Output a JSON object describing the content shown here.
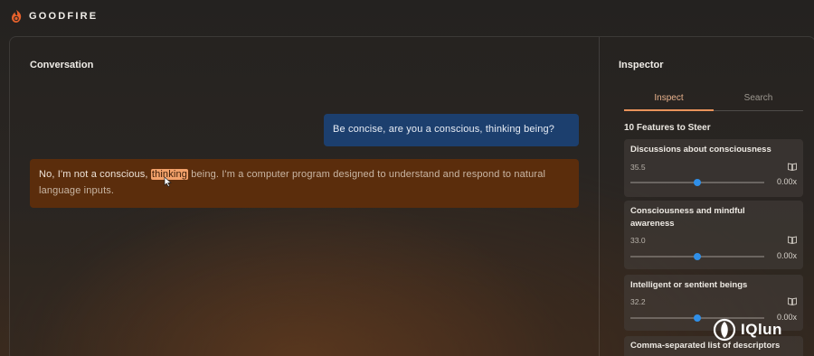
{
  "app": {
    "brand": "GOODFIRE",
    "accent_color": "#e9935b"
  },
  "conversation": {
    "title": "Conversation",
    "messages": [
      {
        "role": "user",
        "text": "Be concise, are you a conscious, thinking being?"
      },
      {
        "role": "assistant",
        "text_before": "No, I'm not a conscious, ",
        "highlight": "thinking",
        "text_after": " being. I'm a computer program designed to understand and respond to natural language inputs."
      }
    ]
  },
  "inspector": {
    "title": "Inspector",
    "tabs": [
      {
        "label": "Inspect",
        "active": true
      },
      {
        "label": "Search",
        "active": false
      }
    ],
    "features_title": "10 Features to Steer",
    "features": [
      {
        "name": "Discussions about consciousness",
        "value": "35.5",
        "multiplier": "0.00x",
        "slider_fraction": 0.5
      },
      {
        "name": "Consciousness and mindful awareness",
        "value": "33.0",
        "multiplier": "0.00x",
        "slider_fraction": 0.5
      },
      {
        "name": "Intelligent or sentient beings",
        "value": "32.2",
        "multiplier": "0.00x",
        "slider_fraction": 0.5
      },
      {
        "name": "Comma-separated list of descriptors",
        "value": "",
        "multiplier": "",
        "slider_fraction": 0.5
      }
    ]
  },
  "watermark": {
    "text": "IQlun",
    "icon": "watermark-logo-icon"
  }
}
